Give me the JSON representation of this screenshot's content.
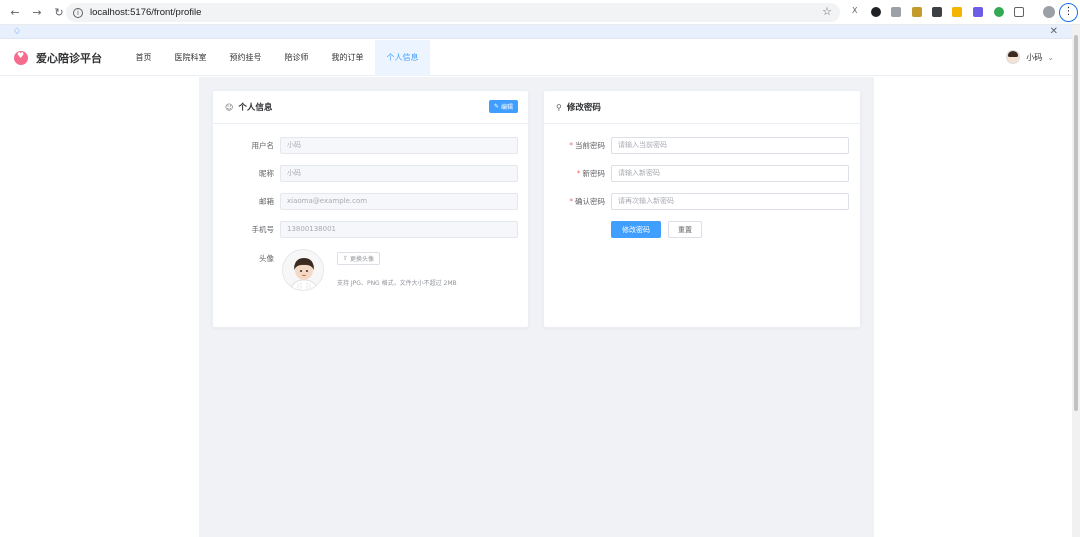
{
  "browser": {
    "url": "localhost:5176/front/profile"
  },
  "app": {
    "brand": "爱心陪诊平台",
    "nav": [
      "首页",
      "医院科室",
      "预约挂号",
      "陪诊师",
      "我的订单",
      "个人信息"
    ],
    "active_nav_index": 5,
    "user_name": "小码"
  },
  "profile_card": {
    "title": "个人信息",
    "edit_label": "编辑",
    "fields": [
      {
        "label": "用户名",
        "value": "小码"
      },
      {
        "label": "昵称",
        "value": "小码"
      },
      {
        "label": "邮箱",
        "value": "xiaoma@example.com"
      },
      {
        "label": "手机号",
        "value": "13800138001"
      }
    ],
    "avatar_label": "头像",
    "change_avatar_label": "更换头像",
    "avatar_hint": "支持 JPG、PNG 格式，文件大小不超过 2MB"
  },
  "password_card": {
    "title": "修改密码",
    "fields": [
      {
        "label": "当前密码",
        "placeholder": "请输入当前密码"
      },
      {
        "label": "新密码",
        "placeholder": "请输入新密码"
      },
      {
        "label": "确认密码",
        "placeholder": "请再次输入新密码"
      }
    ],
    "submit_label": "修改密码",
    "reset_label": "重置"
  },
  "colors": {
    "primary": "#409eff",
    "required": "#f56c6c",
    "page_bg": "#f0f2f5",
    "brand_pink": "#f56c8e"
  }
}
